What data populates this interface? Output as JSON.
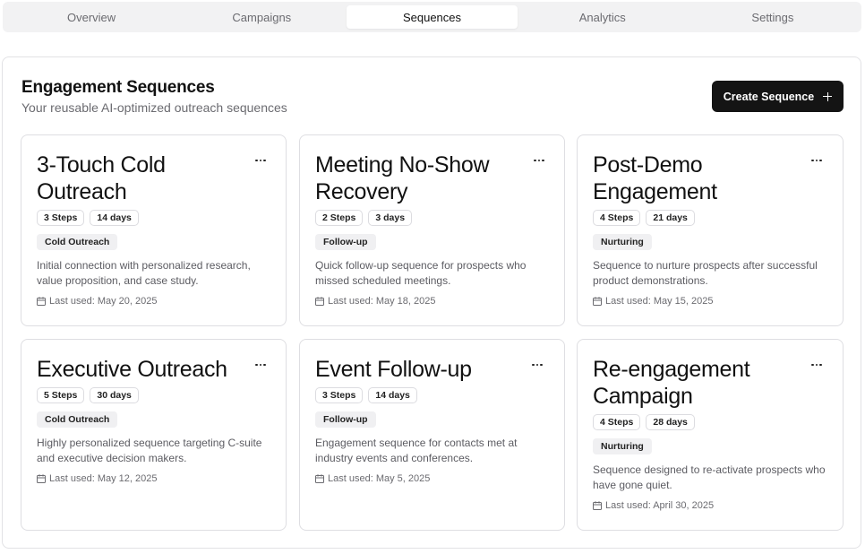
{
  "tabs": [
    {
      "label": "Overview"
    },
    {
      "label": "Campaigns"
    },
    {
      "label": "Sequences"
    },
    {
      "label": "Analytics"
    },
    {
      "label": "Settings"
    }
  ],
  "active_tab": "Sequences",
  "panel": {
    "title": "Engagement Sequences",
    "subtitle": "Your reusable AI-optimized outreach sequences",
    "create_label": "Create Sequence",
    "create_icon": "plus-icon"
  },
  "colors": {
    "primary_button": "#141414",
    "tag_background": "#f0f0f2",
    "muted_text": "#6b6b70"
  },
  "sequences": [
    {
      "title": "3-Touch Cold Outreach",
      "steps": "3 Steps",
      "duration": "14 days",
      "category": "Cold Outreach",
      "description": "Initial connection with personalized research, value proposition, and case study.",
      "last_used": "Last used: May 20, 2025"
    },
    {
      "title": "Meeting No-Show Recovery",
      "steps": "2 Steps",
      "duration": "3 days",
      "category": "Follow-up",
      "description": "Quick follow-up sequence for prospects who missed scheduled meetings.",
      "last_used": "Last used: May 18, 2025"
    },
    {
      "title": "Post-Demo Engagement",
      "steps": "4 Steps",
      "duration": "21 days",
      "category": "Nurturing",
      "description": "Sequence to nurture prospects after successful product demonstrations.",
      "last_used": "Last used: May 15, 2025"
    },
    {
      "title": "Executive Outreach",
      "steps": "5 Steps",
      "duration": "30 days",
      "category": "Cold Outreach",
      "description": "Highly personalized sequence targeting C-suite and executive decision makers.",
      "last_used": "Last used: May 12, 2025"
    },
    {
      "title": "Event Follow-up",
      "steps": "3 Steps",
      "duration": "14 days",
      "category": "Follow-up",
      "description": "Engagement sequence for contacts met at industry events and conferences.",
      "last_used": "Last used: May 5, 2025"
    },
    {
      "title": "Re-engagement Campaign",
      "steps": "4 Steps",
      "duration": "28 days",
      "category": "Nurturing",
      "description": "Sequence designed to re-activate prospects who have gone quiet.",
      "last_used": "Last used: April 30, 2025"
    }
  ]
}
